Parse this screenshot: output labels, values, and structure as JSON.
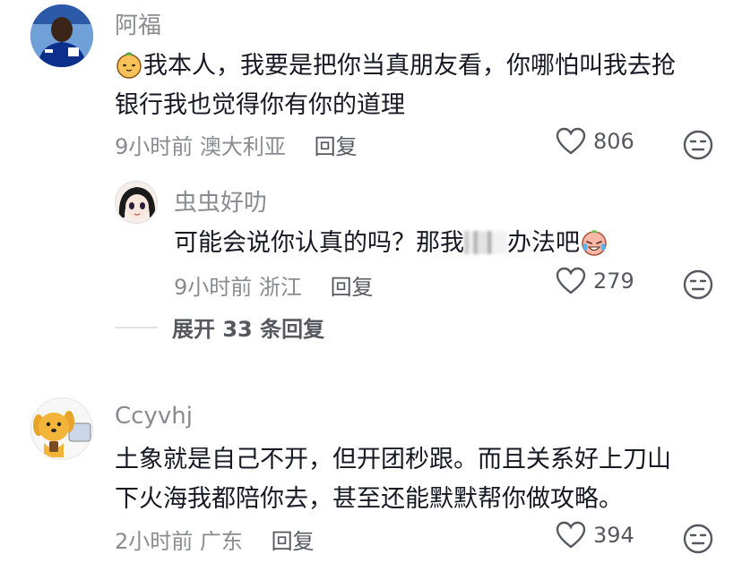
{
  "comments": [
    {
      "author": "阿福",
      "text_lead": "我本人，我要是把你当真朋友看，你哪怕叫我去抢",
      "text_tail": "银行我也觉得你有你的道理",
      "time": "9小时前",
      "location": "澳大利亚",
      "reply_label": "回复",
      "likes": "806",
      "avatar_icon": "football-player-avatar",
      "reply": {
        "author": "虫虫好叻",
        "text_before": "可能会说你认真的吗？那我",
        "text_after": "办法吧",
        "time": "9小时前",
        "location": "浙江",
        "reply_label": "回复",
        "likes": "279",
        "avatar_icon": "anime-girl-avatar"
      },
      "expand_label": "展开 33 条回复"
    },
    {
      "author": "Ccyvhj",
      "text_lead": "土象就是自己不开，但开团秒跟。而且关系好上刀山",
      "text_tail": "下火海我都陪你去，甚至还能默默帮你做攻略。",
      "time": "2小时前",
      "location": "广东",
      "reply_label": "回复",
      "likes": "394",
      "avatar_icon": "cartoon-dog-avatar"
    }
  ],
  "colors": {
    "primary_text": "#161823",
    "secondary_text": "#8a8b91",
    "reply_text": "#57585f",
    "background": "#ffffff"
  }
}
